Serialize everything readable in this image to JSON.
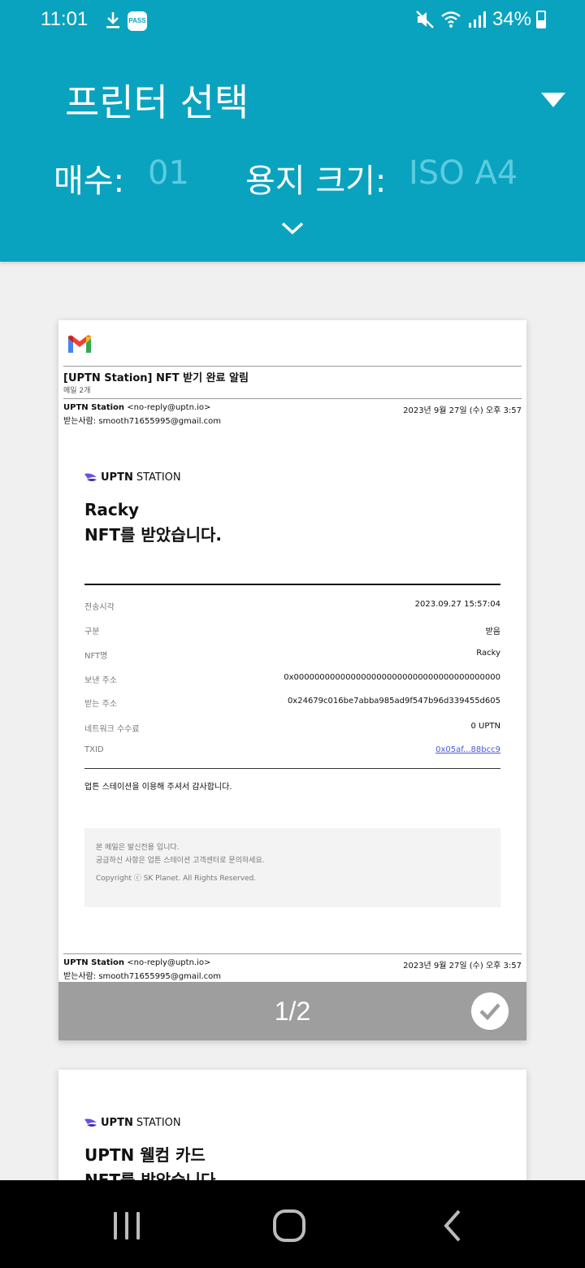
{
  "status_bar": {
    "time": "11:01",
    "pass_badge": "PASS",
    "battery": "34%",
    "icons": [
      "download-icon",
      "pass-app-icon",
      "mute-icon",
      "wifi-icon",
      "signal-icon",
      "battery-icon"
    ]
  },
  "header": {
    "printer_label": "프린터 선택",
    "copies_label": "매수:",
    "copies_value": "01",
    "paper_label": "용지 크기:",
    "paper_value": "ISO A4"
  },
  "page1": {
    "email_subject": "[UPTN Station] NFT 받기 완료 알림",
    "email_count": "메일 2개",
    "sender_name": "UPTN Station",
    "sender_addr": "<no-reply@uptn.io>",
    "date": "2023년 9월 27일 (수) 오후 3:57",
    "recipient": "받는사람: smooth71655995@gmail.com",
    "brand_bold": "UPTN",
    "brand_rest": "STATION",
    "headline_line1": "Racky",
    "headline_line2": "NFT를 받았습니다.",
    "details": [
      {
        "key": "전송시각",
        "value": "2023.09.27 15:57:04"
      },
      {
        "key": "구분",
        "value": "받음"
      },
      {
        "key": "NFT명",
        "value": "Racky"
      },
      {
        "key": "보낸 주소",
        "value": "0x0000000000000000000000000000000000000000"
      },
      {
        "key": "받는 주소",
        "value": "0x24679c016be7abba985ad9f547b96d339455d605"
      },
      {
        "key": "네트워크 수수료",
        "value": "0 UPTN"
      },
      {
        "key": "TXID",
        "value": "0x05af...88bcc9"
      }
    ],
    "thanks": "업튼 스테이션을 이용해 주셔서 감사합니다.",
    "footer_line1": "본 메일은 발신전용 입니다.",
    "footer_line2": "궁금하신 사항은 업튼 스테이션 고객센터로 문의하세요.",
    "footer_line3": "Copyright ⓒ SK Planet. All Rights Reserved.",
    "page_indicator": "1/2"
  },
  "page2": {
    "brand_bold": "UPTN",
    "brand_rest": "STATION",
    "headline_line1": "UPTN 웰컴 카드",
    "headline_line2": "NFT를 받았습니다."
  },
  "colors": {
    "accent": "#0aa3bf",
    "link": "#4a56d8",
    "page_bar": "#9e9e9e"
  }
}
